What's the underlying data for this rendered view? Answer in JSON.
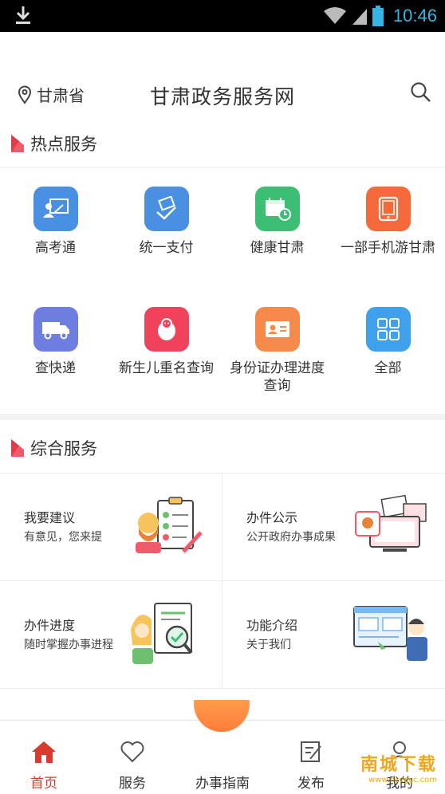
{
  "status_bar": {
    "time": "10:46",
    "download_icon": "download-icon",
    "wifi_icon": "wifi-icon",
    "signal_icon": "signal-icon",
    "battery_icon": "battery-icon"
  },
  "header": {
    "location": "甘肃省",
    "title": "甘肃政务服务网",
    "location_icon": "location-pin-icon",
    "search_icon": "search-icon"
  },
  "hot_services": {
    "title": "热点服务",
    "items": [
      {
        "label": "高考通",
        "icon": "teacher-board-icon",
        "color": "#4a90e2"
      },
      {
        "label": "统一支付",
        "icon": "payment-hand-icon",
        "color": "#4a90e2"
      },
      {
        "label": "健康甘肃",
        "icon": "calendar-clock-icon",
        "color": "#3cbf75"
      },
      {
        "label": "一部手机游甘肃",
        "icon": "tablet-icon",
        "color": "#f5693a"
      },
      {
        "label": "查快递",
        "icon": "truck-icon",
        "color": "#6d7ee0"
      },
      {
        "label": "新生儿重名查询",
        "icon": "baby-icon",
        "color": "#f0425a"
      },
      {
        "label": "身份证办理进度查询",
        "icon": "id-card-icon",
        "color": "#f58a4b"
      },
      {
        "label": "全部",
        "icon": "grid-icon",
        "color": "#3fa1ec"
      }
    ]
  },
  "composite_services": {
    "title": "综合服务",
    "cards": [
      {
        "title": "我要建议",
        "desc": "有意见，您来提",
        "art": "suggestion-illustration"
      },
      {
        "title": "办件公示",
        "desc": "公开政府办事成果",
        "art": "publicity-illustration"
      },
      {
        "title": "办件进度",
        "desc": "随时掌握办事进程",
        "art": "progress-illustration"
      },
      {
        "title": "功能介绍",
        "desc": "关于我们",
        "art": "intro-illustration"
      }
    ]
  },
  "bottom_nav": {
    "items": [
      {
        "label": "首页",
        "icon": "home-icon",
        "active": true
      },
      {
        "label": "服务",
        "icon": "heart-icon"
      },
      {
        "label": "办事指南",
        "icon": "guide-icon"
      },
      {
        "label": "发布",
        "icon": "edit-icon"
      },
      {
        "label": "我的",
        "icon": "user-icon"
      }
    ],
    "active_color": "#d63b2e"
  },
  "watermark": {
    "line1": "南城下载",
    "line2": "www.nccgcc.com"
  }
}
